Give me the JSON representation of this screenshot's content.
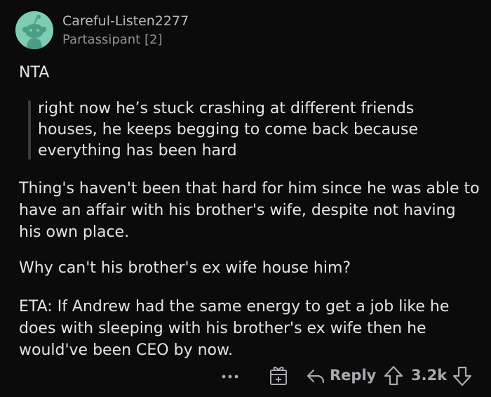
{
  "comment": {
    "author": "Careful-Listen2277",
    "flair": "Partassipant [2]",
    "verdict": "NTA",
    "quote": "right now he’s stuck crashing at different friends houses, he keeps begging to come back because everything has been hard",
    "paragraph_1": "Thing's haven't been that hard for him since he was able to have an affair with his brother's wife, despite not having his own place.",
    "paragraph_2": "Why can't his brother's ex wife house him?",
    "paragraph_3": "ETA: If Andrew had the same energy to get a job like he does with sleeping with his brother's ex wife then he would've been CEO by now."
  },
  "actions": {
    "more_label": "•••",
    "reply_label": "Reply",
    "score": "3.2k"
  },
  "avatar": {
    "background_color": "#7ecdb2",
    "icon": "snoo-avatar-icon"
  },
  "icons": {
    "more": "more-options-icon",
    "award": "gift-award-icon",
    "reply": "reply-arrow-icon",
    "upvote": "upvote-arrow-icon",
    "downvote": "downvote-arrow-icon"
  }
}
